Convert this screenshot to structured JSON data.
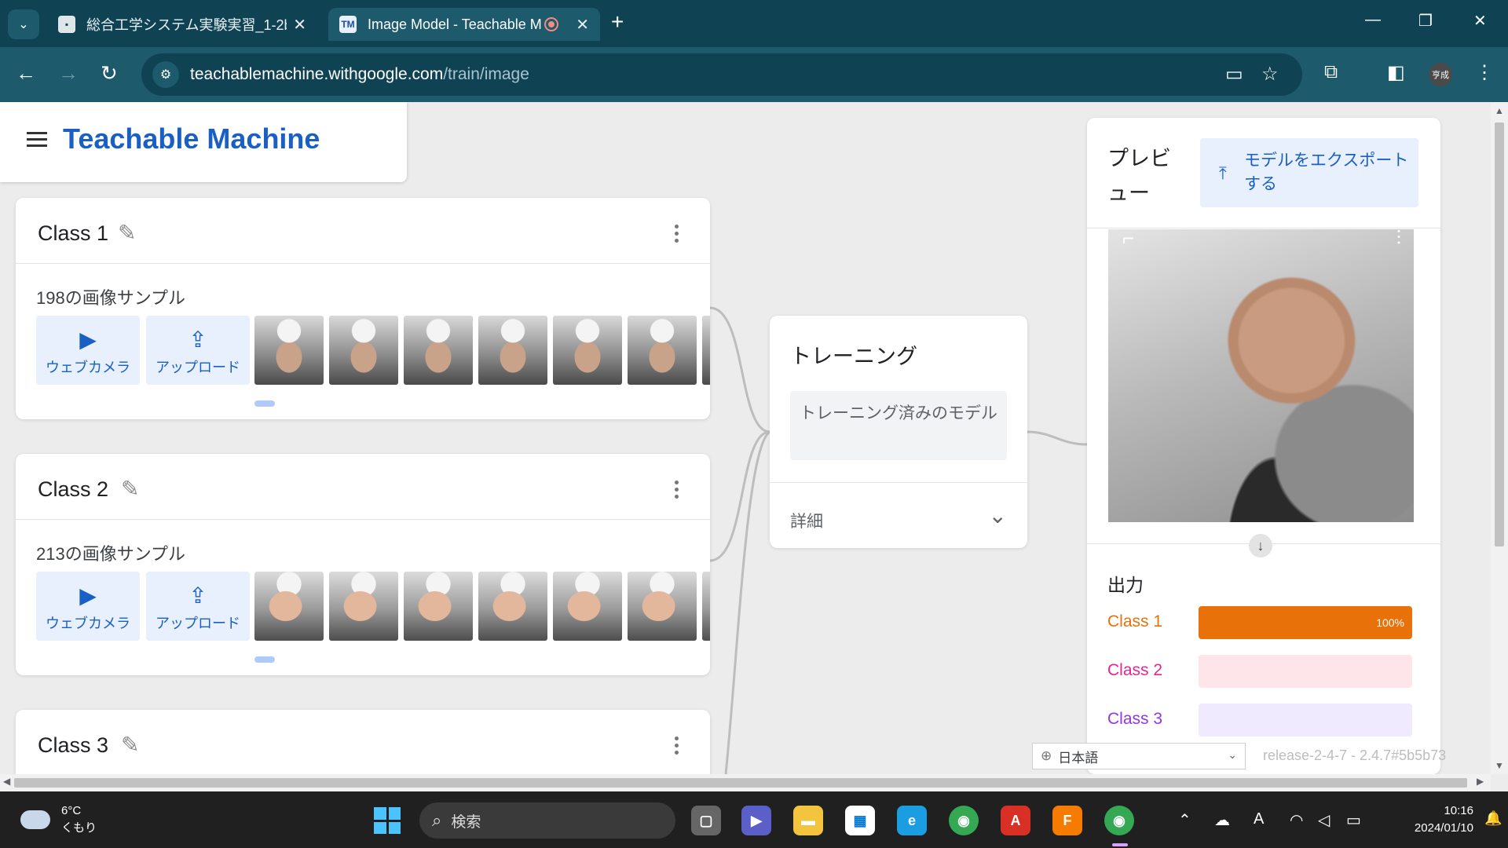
{
  "browser": {
    "tabs": [
      {
        "title": "総合工学システム実験実習_1-2b",
        "favicon": "TM",
        "active": false
      },
      {
        "title": "Image Model - Teachable M",
        "favicon": "TM",
        "active": true
      }
    ],
    "url_host": "teachablemachine.withgoogle.com",
    "url_path": "/train/image",
    "profile_initials": "亨成"
  },
  "app": {
    "brand": "Teachable Machine",
    "classes": [
      {
        "name": "Class 1",
        "samples": "198の画像サンプル",
        "webcam_label": "ウェブカメラ",
        "upload_label": "アップロード",
        "thumbnail_kind": "fist"
      },
      {
        "name": "Class 2",
        "samples": "213の画像サンプル",
        "webcam_label": "ウェブカメラ",
        "upload_label": "アップロード",
        "thumbnail_kind": "hand"
      },
      {
        "name": "Class 3"
      }
    ],
    "training": {
      "title": "トレーニング",
      "button": "トレーニング済みのモデル",
      "details": "詳細"
    },
    "preview": {
      "title": "プレビュー",
      "export_label": "モデルをエクスポートする",
      "output_title": "出力",
      "outputs": [
        {
          "label": "Class 1",
          "percent": 100,
          "percent_text": "100%",
          "color": "#e8710a",
          "track": "#e8710a"
        },
        {
          "label": "Class 2",
          "percent": 0,
          "percent_text": "",
          "color": "#e52592",
          "track": "#fde5ea"
        },
        {
          "label": "Class 3",
          "percent": 0,
          "percent_text": "",
          "color": "#9334e6",
          "track": "#efeafe"
        }
      ]
    },
    "language": "日本語",
    "version": "release-2-4-7 - 2.4.7#5b5b73"
  },
  "taskbar": {
    "weather_temp": "6°C",
    "weather_desc": "くもり",
    "search_placeholder": "検索",
    "time": "10:16",
    "date": "2024/01/10"
  },
  "colors": {
    "brand_blue": "#1a5fc4",
    "chrome_dark": "#0f4354",
    "chrome_mid": "#1d5a6c"
  }
}
